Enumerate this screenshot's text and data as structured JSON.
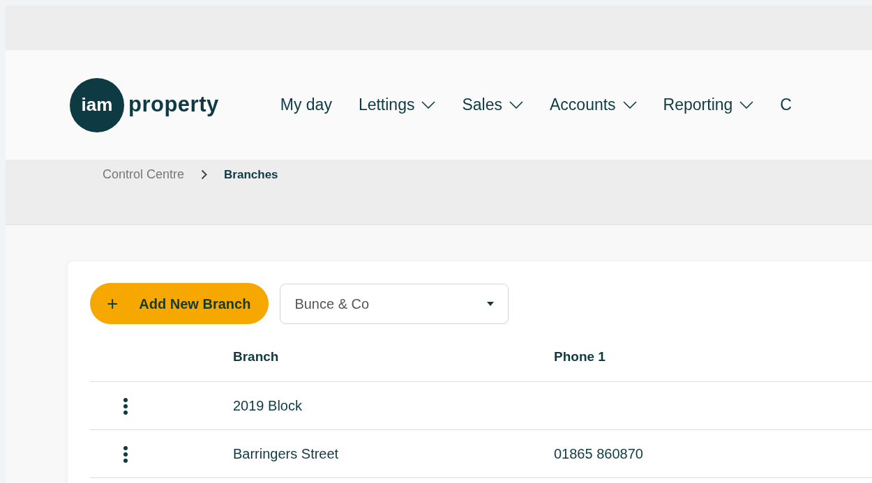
{
  "header": {
    "logo": {
      "circle_text": "iam",
      "word": "property"
    },
    "nav": [
      {
        "label": "My day",
        "dropdown": false
      },
      {
        "label": "Lettings",
        "dropdown": true
      },
      {
        "label": "Sales",
        "dropdown": true
      },
      {
        "label": "Accounts",
        "dropdown": true
      },
      {
        "label": "Reporting",
        "dropdown": true
      },
      {
        "label": "C",
        "dropdown": false
      }
    ]
  },
  "breadcrumb": [
    {
      "label": "Control Centre",
      "current": false
    },
    {
      "label": "Branches",
      "current": true
    }
  ],
  "toolbar": {
    "add_button": {
      "icon": "+",
      "label": "Add New Branch"
    },
    "company_select": {
      "value": "Bunce & Co"
    }
  },
  "table": {
    "columns": [
      "Branch",
      "Phone 1"
    ],
    "rows": [
      {
        "branch": "2019 Block"
      },
      {
        "branch": "Barringers Street",
        "phone_1": "01865 860870"
      }
    ]
  }
}
